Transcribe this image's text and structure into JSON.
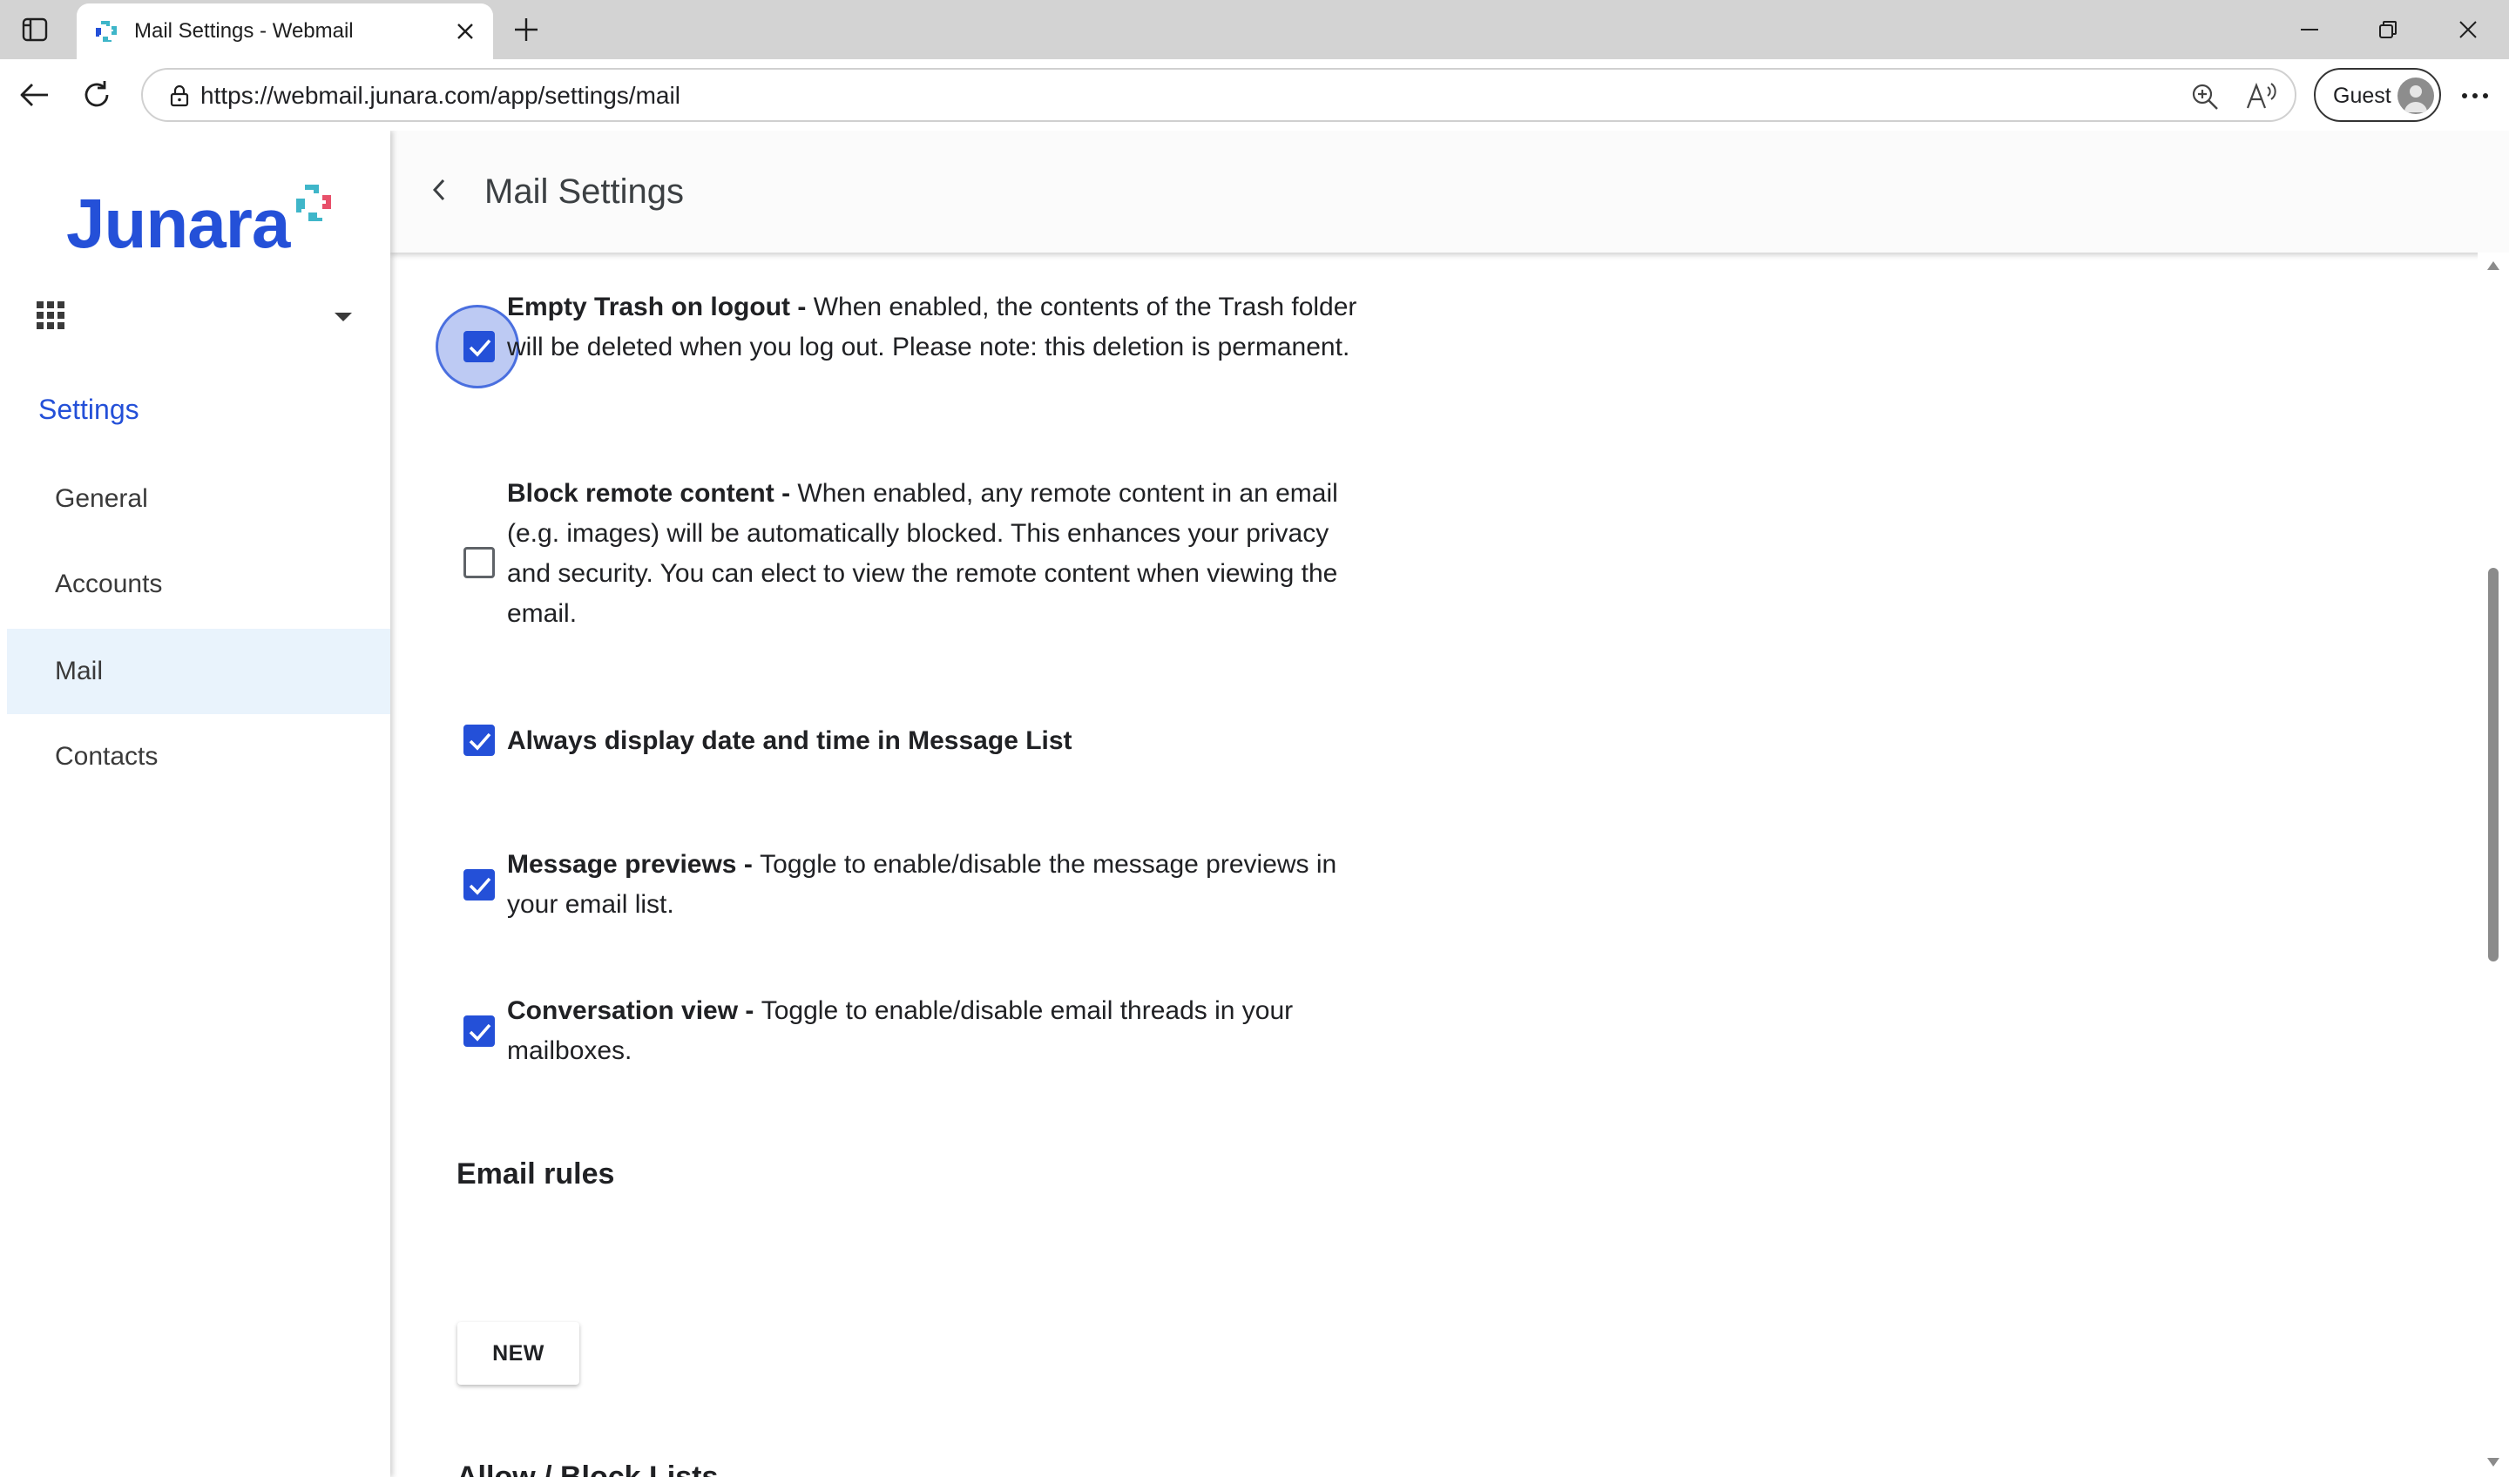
{
  "browser": {
    "tab_title": "Mail Settings - Webmail",
    "url": "https://webmail.junara.com/app/settings/mail",
    "profile_label": "Guest"
  },
  "sidebar": {
    "logo_text": "Junara",
    "section_heading": "Settings",
    "items": [
      {
        "label": "General",
        "active": false
      },
      {
        "label": "Accounts",
        "active": false
      },
      {
        "label": "Mail",
        "active": true
      },
      {
        "label": "Contacts",
        "active": false
      }
    ]
  },
  "header": {
    "title": "Mail Settings"
  },
  "settings": [
    {
      "title": "Empty Trash on logout",
      "separator": " - ",
      "description": "When enabled, the contents of the Trash folder will be deleted when you log out. Please note: this deletion is permanent.",
      "checked": true,
      "focused": true
    },
    {
      "title": "Block remote content",
      "separator": " - ",
      "description": "When enabled, any remote content in an email (e.g. images) will be automatically blocked. This enhances your privacy and security. You can elect to view the remote content when viewing the email.",
      "checked": false,
      "focused": false
    },
    {
      "title": "Always display date and time in Message List",
      "separator": "",
      "description": "",
      "checked": true,
      "focused": false
    },
    {
      "title": "Message previews",
      "separator": " - ",
      "description": "Toggle to enable/disable the message previews in your email list.",
      "checked": true,
      "focused": false
    },
    {
      "title": "Conversation view",
      "separator": " - ",
      "description": "Toggle to enable/disable email threads in your mailboxes.",
      "checked": true,
      "focused": false
    }
  ],
  "email_rules": {
    "heading": "Email rules",
    "new_button_label": "NEW"
  },
  "next_section_heading": "Allow / Block Lists",
  "colors": {
    "accent": "#2450d8",
    "active_nav_bg": "#e9f3fc",
    "titlebar_bg": "#d3d3d3"
  }
}
